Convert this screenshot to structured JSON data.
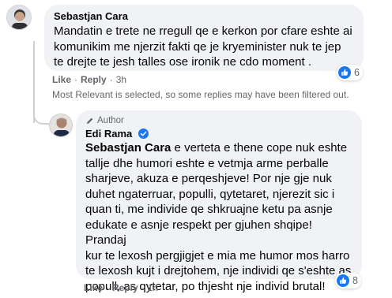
{
  "comment1": {
    "author": "Sebastjan Cara",
    "text": "Mandatin e trete ne rregull qe e kerkon por cfare eshte ai\nkomunikim me njerzit fakti qe je kryeminister nuk te jep\nte drejte te jesh talles ose ironik ne cdo moment .",
    "actions": {
      "like": "Like",
      "reply": "Reply",
      "time": "3h"
    },
    "reaction_count": "6"
  },
  "filter_note": "Most Relevant is selected, so some replies may have been filtered out.",
  "reply1": {
    "badge": "Author",
    "author": "Edi Rama",
    "mention": "Sebastjan Cara",
    "text": " e verteta e thene cope nuk eshte\ntallje dhe humori eshte e vetmja arme perballe\nsharjeve, akuza e perqeshjeve! Por nje gje nuk\nduhet ngaterruar, populli, qytetaret, njerezit sic i\nquan ti, me individe qe shkruajne ketu pa asnje\nedukate e asnje respekt per gjuhen shqipe! Prandaj\nkur te lexosh pergjigjet e mia me humor mos harro\nte lexosh kujt i drejtohem, nje individi qe s'eshte as\npopull, as qytetar, po thjesht nje individ brutal!",
    "actions": {
      "like": "Like",
      "reply": "Reply",
      "time": "1h"
    },
    "reaction_count": "8"
  },
  "colors": {
    "like_blue": "#1877f2",
    "verified_blue": "#1877f2",
    "muted": "#65676b",
    "bubble": "#f0f2f5"
  },
  "icons": {
    "like": "thumbs-up-icon",
    "verified": "verified-badge-icon",
    "author_badge": "pen-icon"
  }
}
